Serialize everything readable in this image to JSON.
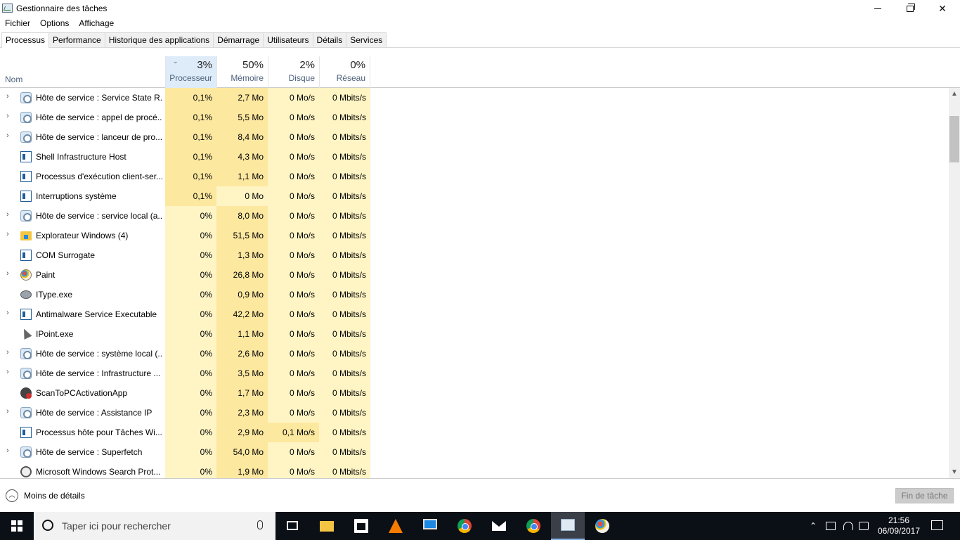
{
  "window": {
    "title": "Gestionnaire des tâches",
    "controls": {
      "minimize": "minimize",
      "maximize": "restore",
      "close": "close"
    }
  },
  "menu": [
    "Fichier",
    "Options",
    "Affichage"
  ],
  "tabs": [
    {
      "label": "Processus",
      "active": true
    },
    {
      "label": "Performance",
      "active": false
    },
    {
      "label": "Historique des applications",
      "active": false
    },
    {
      "label": "Démarrage",
      "active": false
    },
    {
      "label": "Utilisateurs",
      "active": false
    },
    {
      "label": "Détails",
      "active": false
    },
    {
      "label": "Services",
      "active": false
    }
  ],
  "columns": {
    "name": "Nom",
    "cpu": {
      "pct": "3%",
      "label": "Processeur"
    },
    "memory": {
      "pct": "50%",
      "label": "Mémoire"
    },
    "disk": {
      "pct": "2%",
      "label": "Disque"
    },
    "network": {
      "pct": "0%",
      "label": "Réseau"
    }
  },
  "processes": [
    {
      "name": "Hôte de service : Service State R...",
      "icon": "gear-icon",
      "expandable": true,
      "cpu": "0,1%",
      "mem": "2,7 Mo",
      "disk": "0 Mo/s",
      "net": "0 Mbits/s"
    },
    {
      "name": "Hôte de service : appel de procé...",
      "icon": "gear-icon",
      "expandable": true,
      "cpu": "0,1%",
      "mem": "5,5 Mo",
      "disk": "0 Mo/s",
      "net": "0 Mbits/s"
    },
    {
      "name": "Hôte de service : lanceur de pro...",
      "icon": "gear-icon",
      "expandable": true,
      "cpu": "0,1%",
      "mem": "8,4 Mo",
      "disk": "0 Mo/s",
      "net": "0 Mbits/s"
    },
    {
      "name": "Shell Infrastructure Host",
      "icon": "window-icon",
      "expandable": false,
      "cpu": "0,1%",
      "mem": "4,3 Mo",
      "disk": "0 Mo/s",
      "net": "0 Mbits/s"
    },
    {
      "name": "Processus d'exécution client-ser...",
      "icon": "window-icon",
      "expandable": false,
      "cpu": "0,1%",
      "mem": "1,1 Mo",
      "disk": "0 Mo/s",
      "net": "0 Mbits/s"
    },
    {
      "name": "Interruptions système",
      "icon": "window-icon",
      "expandable": false,
      "cpu": "0,1%",
      "mem": "0 Mo",
      "disk": "0 Mo/s",
      "net": "0 Mbits/s"
    },
    {
      "name": "Hôte de service : service local (a...",
      "icon": "gear-icon",
      "expandable": true,
      "cpu": "0%",
      "mem": "8,0 Mo",
      "disk": "0 Mo/s",
      "net": "0 Mbits/s"
    },
    {
      "name": "Explorateur Windows (4)",
      "icon": "folder-icon",
      "expandable": true,
      "cpu": "0%",
      "mem": "51,5 Mo",
      "disk": "0 Mo/s",
      "net": "0 Mbits/s"
    },
    {
      "name": "COM Surrogate",
      "icon": "window-icon",
      "expandable": false,
      "cpu": "0%",
      "mem": "1,3 Mo",
      "disk": "0 Mo/s",
      "net": "0 Mbits/s"
    },
    {
      "name": "Paint",
      "icon": "paint-icon",
      "expandable": true,
      "cpu": "0%",
      "mem": "26,8 Mo",
      "disk": "0 Mo/s",
      "net": "0 Mbits/s"
    },
    {
      "name": "IType.exe",
      "icon": "disk-icon",
      "expandable": false,
      "cpu": "0%",
      "mem": "0,9 Mo",
      "disk": "0 Mo/s",
      "net": "0 Mbits/s"
    },
    {
      "name": "Antimalware Service Executable",
      "icon": "window-icon",
      "expandable": true,
      "cpu": "0%",
      "mem": "42,2 Mo",
      "disk": "0 Mo/s",
      "net": "0 Mbits/s"
    },
    {
      "name": "IPoint.exe",
      "icon": "cursor-icon",
      "expandable": false,
      "cpu": "0%",
      "mem": "1,1 Mo",
      "disk": "0 Mo/s",
      "net": "0 Mbits/s"
    },
    {
      "name": "Hôte de service : système local (...",
      "icon": "gear-icon",
      "expandable": true,
      "cpu": "0%",
      "mem": "2,6 Mo",
      "disk": "0 Mo/s",
      "net": "0 Mbits/s"
    },
    {
      "name": "Hôte de service : Infrastructure ...",
      "icon": "gear-icon",
      "expandable": true,
      "cpu": "0%",
      "mem": "3,5 Mo",
      "disk": "0 Mo/s",
      "net": "0 Mbits/s"
    },
    {
      "name": "ScanToPCActivationApp",
      "icon": "scan-icon",
      "expandable": false,
      "cpu": "0%",
      "mem": "1,7 Mo",
      "disk": "0 Mo/s",
      "net": "0 Mbits/s"
    },
    {
      "name": "Hôte de service : Assistance IP",
      "icon": "gear-icon",
      "expandable": true,
      "cpu": "0%",
      "mem": "2,3 Mo",
      "disk": "0 Mo/s",
      "net": "0 Mbits/s"
    },
    {
      "name": "Processus hôte pour Tâches Wi...",
      "icon": "window-icon",
      "expandable": false,
      "cpu": "0%",
      "mem": "2,9 Mo",
      "disk": "0,1 Mo/s",
      "net": "0 Mbits/s"
    },
    {
      "name": "Hôte de service : Superfetch",
      "icon": "gear-icon",
      "expandable": true,
      "cpu": "0%",
      "mem": "54,0 Mo",
      "disk": "0 Mo/s",
      "net": "0 Mbits/s"
    },
    {
      "name": "Microsoft Windows Search Prot...",
      "icon": "search-icon",
      "expandable": false,
      "cpu": "0%",
      "mem": "1,9 Mo",
      "disk": "0 Mo/s",
      "net": "0 Mbits/s"
    }
  ],
  "footer": {
    "less_details": "Moins de détails",
    "end_task": "Fin de tâche"
  },
  "taskbar": {
    "search_placeholder": "Taper ici pour rechercher",
    "apps": [
      "task-view-icon",
      "file-explorer-icon",
      "store-icon",
      "vlc-icon",
      "monitor-icon",
      "chrome-icon",
      "mail-icon",
      "chrome-icon",
      "task-manager-icon",
      "paint-icon"
    ],
    "time": "21:56",
    "date": "06/09/2017"
  },
  "colors": {
    "heat_low": "#fff4c4",
    "heat_mid": "#fde8a0",
    "heat_high": "#f9e79f",
    "sorted_header": "#deecf9",
    "taskbar": "#0b0f16"
  }
}
